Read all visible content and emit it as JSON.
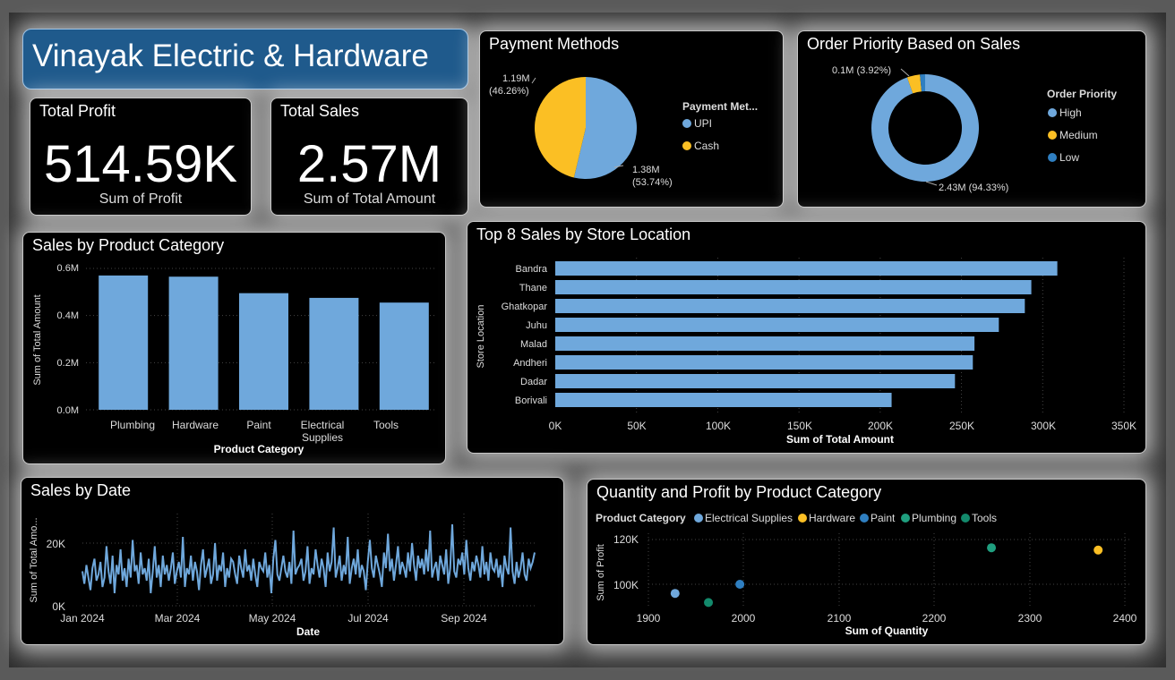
{
  "colors": {
    "blue": "#6fa8dc",
    "orange": "#fbbf24",
    "darkblue": "#2f7fc1",
    "teal": "#1f9f7f",
    "teal2": "#138a6c"
  },
  "header": {
    "title": "Vinayak Electric & Hardware"
  },
  "kpis": {
    "profit": {
      "title": "Total Profit",
      "value": "514.59K",
      "sub": "Sum of Profit"
    },
    "sales": {
      "title": "Total Sales",
      "value": "2.57M",
      "sub": "Sum of Total Amount"
    }
  },
  "payment": {
    "title": "Payment Methods",
    "legend_title": "Payment Met...",
    "legend": [
      "UPI",
      "Cash"
    ],
    "label_cash_1": "1.19M",
    "label_cash_2": "(46.26%)",
    "label_upi_1": "1.38M",
    "label_upi_2": "(53.74%)"
  },
  "priority": {
    "title": "Order Priority Based on Sales",
    "legend_title": "Order Priority",
    "legend": [
      "High",
      "Medium",
      "Low"
    ],
    "label_medium": "0.1M (3.92%)",
    "label_high": "2.43M (94.33%)"
  },
  "category": {
    "title": "Sales by Product Category",
    "xlabel": "Product Category",
    "ylabel": "Sum of Total Amount",
    "yticks": [
      "0.0M",
      "0.2M",
      "0.4M",
      "0.6M"
    ],
    "cat_labels": [
      "Plumbing",
      "Hardware",
      "Paint",
      "Electrical",
      "Supplies",
      "Tools"
    ]
  },
  "store": {
    "title": "Top 8 Sales by Store Location",
    "xlabel": "Sum of Total Amount",
    "ylabel": "Store Location",
    "xticks": [
      "0K",
      "50K",
      "100K",
      "150K",
      "200K",
      "250K",
      "300K",
      "350K"
    ]
  },
  "date": {
    "title": "Sales by Date",
    "xlabel": "Date",
    "ylabel": "Sum of Total Amo...",
    "yticks": [
      "0K",
      "20K"
    ],
    "xticks": [
      "Jan 2024",
      "Mar 2024",
      "May 2024",
      "Jul 2024",
      "Sep 2024"
    ]
  },
  "scatter": {
    "title": "Quantity and Profit by Product Category",
    "legend_title": "Product Category",
    "legend": [
      "Electrical Supplies",
      "Hardware",
      "Paint",
      "Plumbing",
      "Tools"
    ],
    "xlabel": "Sum of Quantity",
    "ylabel": "Sum of Profit",
    "xticks": [
      "1900",
      "2000",
      "2100",
      "2200",
      "2300",
      "2400"
    ],
    "yticks": [
      "100K",
      "120K"
    ]
  },
  "chart_data": [
    {
      "type": "pie",
      "title": "Payment Methods",
      "labels": [
        "UPI",
        "Cash"
      ],
      "values": [
        1.38,
        1.19
      ],
      "percent": [
        53.74,
        46.26
      ]
    },
    {
      "type": "pie",
      "title": "Order Priority Based on Sales",
      "labels": [
        "High",
        "Medium",
        "Low"
      ],
      "values": [
        2.43,
        0.1,
        0.04
      ],
      "percent": [
        94.33,
        3.92,
        1.75
      ]
    },
    {
      "type": "bar",
      "title": "Sales by Product Category",
      "categories": [
        "Plumbing",
        "Hardware",
        "Paint",
        "Electrical Supplies",
        "Tools"
      ],
      "values": [
        0.57,
        0.565,
        0.495,
        0.475,
        0.455
      ],
      "ylim": [
        0,
        0.6
      ],
      "xlabel": "Product Category",
      "ylabel": "Sum of Total Amount"
    },
    {
      "type": "bar",
      "title": "Top 8 Sales by Store Location",
      "categories": [
        "Bandra",
        "Thane",
        "Ghatkopar",
        "Juhu",
        "Malad",
        "Andheri",
        "Dadar",
        "Borivali"
      ],
      "values": [
        309,
        293,
        289,
        273,
        258,
        257,
        246,
        207
      ],
      "xlim": [
        0,
        350
      ],
      "xlabel": "Sum of Total Amount",
      "ylabel": "Store Location"
    },
    {
      "type": "line",
      "title": "Sales by Date",
      "xlabel": "Date",
      "ylabel": "Sum of Total Amount",
      "ylim": [
        0,
        28
      ],
      "x_start": "2024-01-01",
      "x_end": "2024-10-10",
      "values": [
        11,
        7,
        13,
        9,
        5,
        12,
        15,
        8,
        10,
        14,
        6,
        9,
        19,
        11,
        7,
        16,
        4,
        13,
        10,
        18,
        8,
        12,
        6,
        15,
        9,
        21,
        11,
        13,
        7,
        17,
        10,
        12,
        8,
        15,
        4,
        11,
        19,
        9,
        13,
        6,
        16,
        10,
        13,
        8,
        12,
        17,
        7,
        11,
        14,
        9,
        22,
        6,
        12,
        10,
        16,
        8,
        14,
        11,
        5,
        13,
        18,
        9,
        12,
        15,
        7,
        10,
        20,
        8,
        13,
        11,
        17,
        6,
        12,
        9,
        15,
        14,
        10,
        7,
        16,
        12,
        9,
        18,
        11,
        13,
        8,
        15,
        10,
        6,
        14,
        12,
        11,
        17,
        9,
        13,
        4,
        15,
        21,
        10,
        8,
        12,
        16,
        11,
        9,
        14,
        7,
        24,
        10,
        12,
        13,
        15,
        8,
        11,
        19,
        7,
        12,
        10,
        18,
        13,
        9,
        15,
        12,
        6,
        17,
        11,
        14,
        25,
        9,
        12,
        16,
        8,
        13,
        10,
        22,
        7,
        12,
        15,
        10,
        18,
        9,
        13,
        11,
        5,
        14,
        21,
        12,
        9,
        16,
        13,
        10,
        6,
        17,
        12,
        23,
        11,
        15,
        8,
        13,
        19,
        10,
        14,
        12,
        9,
        17,
        11,
        20,
        13,
        8,
        16,
        12,
        15,
        10,
        18,
        11,
        24,
        9,
        12,
        14,
        8,
        16,
        13,
        10,
        18,
        7,
        12,
        26,
        11,
        9,
        15,
        13,
        17,
        10,
        21,
        12,
        8,
        14,
        11,
        16,
        13,
        9,
        19,
        10,
        14,
        8,
        17,
        12,
        11,
        15,
        9,
        13,
        6,
        16,
        12,
        10,
        25,
        11,
        7,
        14,
        9,
        12,
        17,
        10,
        8,
        15,
        12,
        14,
        17
      ]
    },
    {
      "type": "scatter",
      "title": "Quantity and Profit by Product Category",
      "xlabel": "Sum of Quantity",
      "ylabel": "Sum of Profit",
      "points": [
        {
          "name": "Electrical Supplies",
          "x": 1928,
          "y": 96
        },
        {
          "name": "Hardware",
          "x": 2372,
          "y": 115
        },
        {
          "name": "Paint",
          "x": 1996,
          "y": 100
        },
        {
          "name": "Plumbing",
          "x": 2260,
          "y": 116
        },
        {
          "name": "Tools",
          "x": 1963,
          "y": 92
        }
      ]
    }
  ]
}
